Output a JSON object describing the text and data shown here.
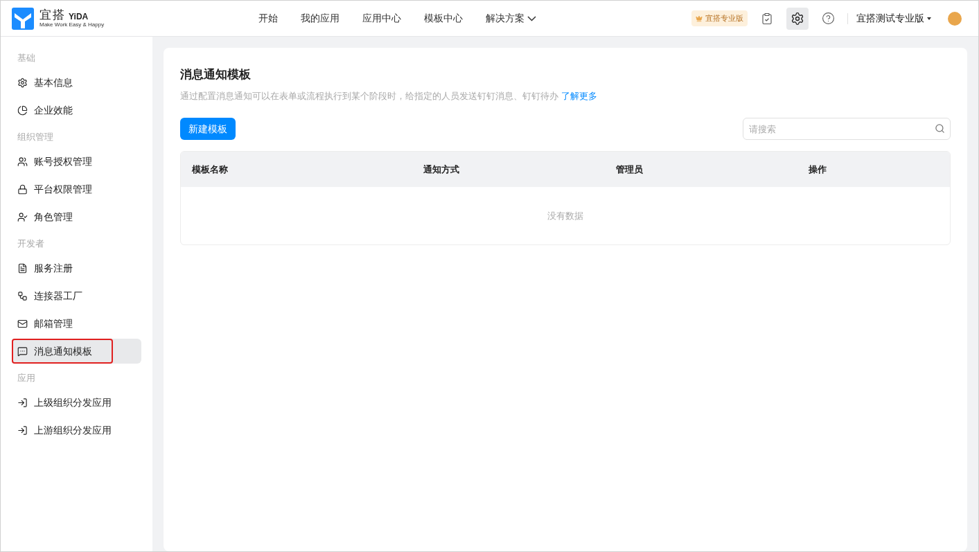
{
  "header": {
    "logo": {
      "name": "宜搭",
      "brand": "YiDA",
      "slogan": "Make Work Easy & Happy"
    },
    "nav": [
      {
        "label": "开始",
        "selected": false
      },
      {
        "label": "我的应用",
        "selected": false
      },
      {
        "label": "应用中心",
        "selected": false
      },
      {
        "label": "模板中心",
        "selected": false
      },
      {
        "label": "解决方案",
        "selected": false,
        "dropdown": true
      }
    ],
    "edition_badge": "宜搭专业版",
    "settings_active": true,
    "org_name": "宜搭测试专业版"
  },
  "sidebar": {
    "groups": [
      {
        "heading": "基础",
        "items": [
          {
            "label": "基本信息",
            "selected": false
          },
          {
            "label": "企业效能",
            "selected": false
          }
        ]
      },
      {
        "heading": "组织管理",
        "items": [
          {
            "label": "账号授权管理",
            "selected": false
          },
          {
            "label": "平台权限管理",
            "selected": false
          },
          {
            "label": "角色管理",
            "selected": false
          }
        ]
      },
      {
        "heading": "开发者",
        "items": [
          {
            "label": "服务注册",
            "selected": false
          },
          {
            "label": "连接器工厂",
            "selected": false
          },
          {
            "label": "邮箱管理",
            "selected": false
          },
          {
            "label": "消息通知模板",
            "selected": true,
            "annotated": true
          }
        ]
      },
      {
        "heading": "应用",
        "items": [
          {
            "label": "上级组织分发应用",
            "selected": false
          },
          {
            "label": "上游组织分发应用",
            "selected": false
          }
        ]
      }
    ]
  },
  "main": {
    "title": "消息通知模板",
    "description": "通过配置消息通知可以在表单或流程执行到某个阶段时，给指定的人员发送钉钉消息、钉钉待办",
    "learn_more": "了解更多",
    "new_button": "新建模板",
    "search": {
      "placeholder": "请搜索"
    },
    "table": {
      "columns": [
        "模板名称",
        "通知方式",
        "管理员",
        "操作"
      ],
      "empty_text": "没有数据"
    }
  }
}
